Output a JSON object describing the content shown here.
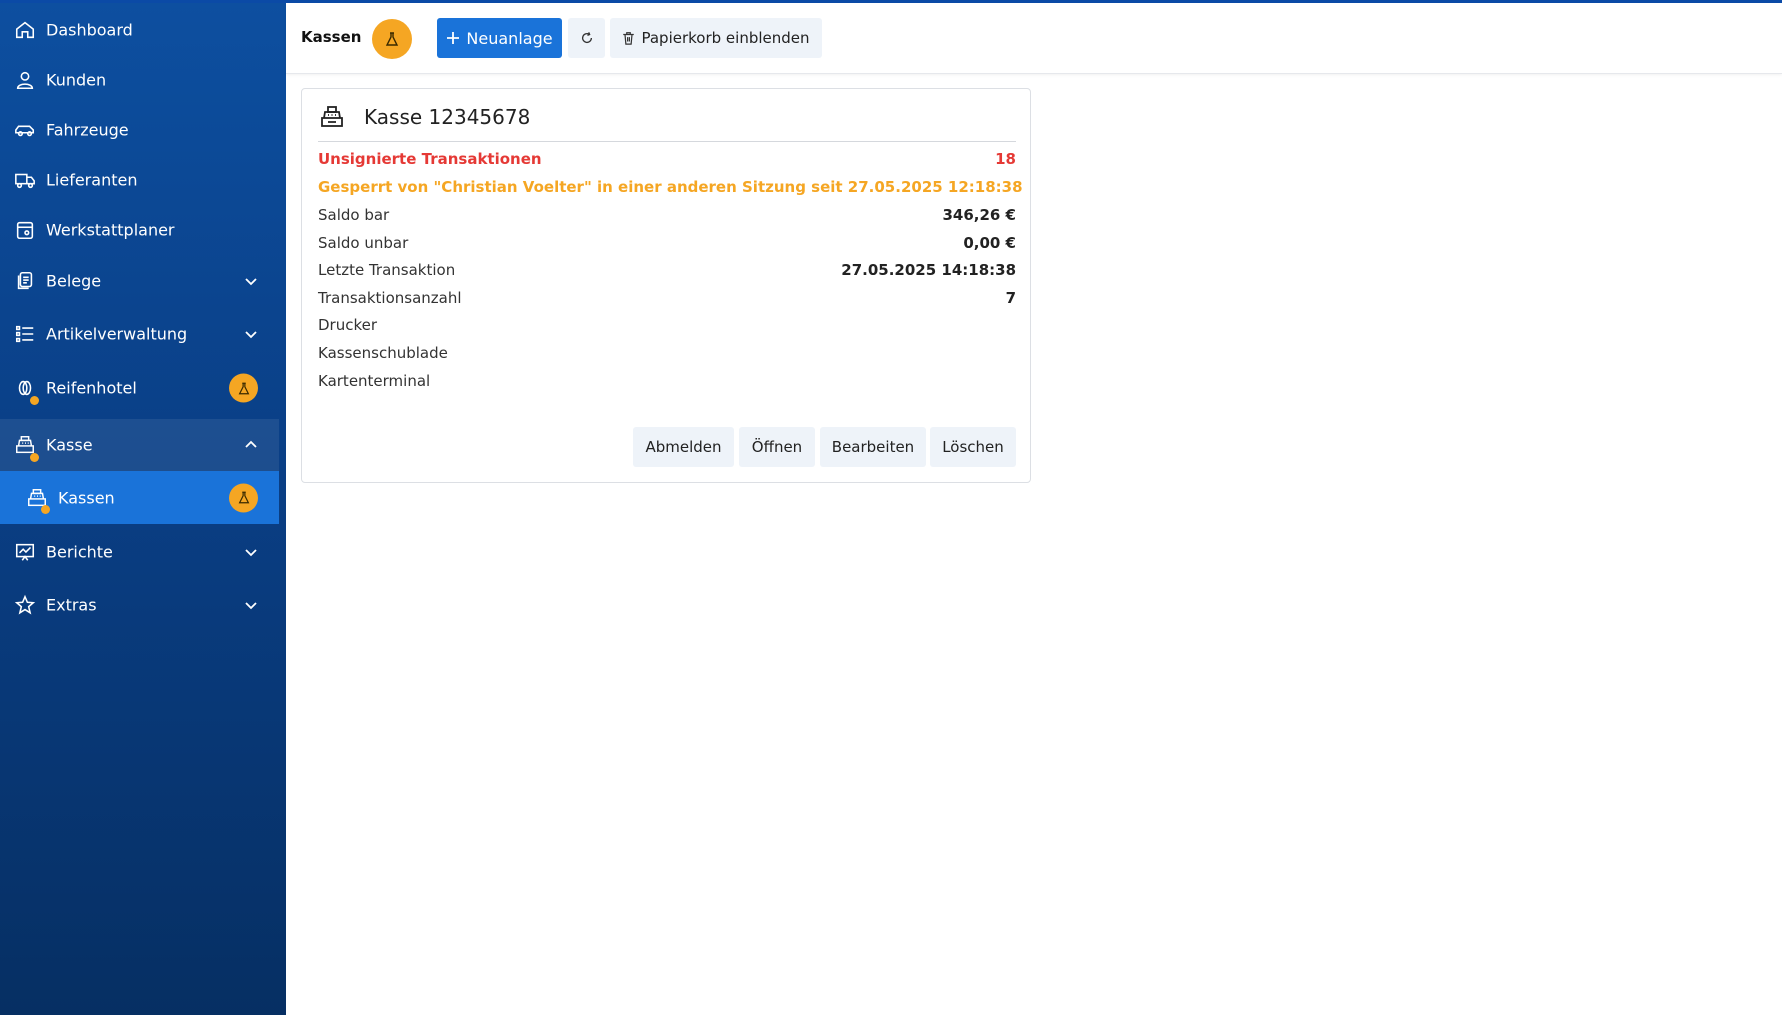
{
  "sidebar": {
    "items": [
      {
        "label": "Dashboard",
        "icon": "home-icon"
      },
      {
        "label": "Kunden",
        "icon": "user-icon"
      },
      {
        "label": "Fahrzeuge",
        "icon": "car-icon"
      },
      {
        "label": "Lieferanten",
        "icon": "truck-icon"
      },
      {
        "label": "Werkstattplaner",
        "icon": "planner-icon"
      },
      {
        "label": "Belege",
        "icon": "documents-icon"
      },
      {
        "label": "Artikelverwaltung",
        "icon": "list-icon"
      },
      {
        "label": "Reifenhotel",
        "icon": "tire-icon"
      },
      {
        "label": "Kasse",
        "icon": "cash-register-icon"
      },
      {
        "label": "Kassen",
        "icon": "cash-register-icon"
      },
      {
        "label": "Berichte",
        "icon": "chart-icon"
      },
      {
        "label": "Extras",
        "icon": "star-icon"
      }
    ]
  },
  "toolbar": {
    "title": "Kassen",
    "new_label": "Neuanlage",
    "trash_label": "Papierkorb einblenden"
  },
  "card": {
    "title": "Kasse 12345678",
    "unsigned_label": "Unsignierte Transaktionen",
    "unsigned_value": "18",
    "locked_text": "Gesperrt von \"Christian Voelter\" in einer anderen Sitzung seit 27.05.2025 12:18:38",
    "rows": [
      {
        "label": "Saldo bar",
        "value": "346,26 €"
      },
      {
        "label": "Saldo unbar",
        "value": "0,00 €"
      },
      {
        "label": "Letzte Transaktion",
        "value": "27.05.2025 14:18:38"
      },
      {
        "label": "Transaktionsanzahl",
        "value": "7"
      },
      {
        "label": "Drucker",
        "value": ""
      },
      {
        "label": "Kassenschublade",
        "value": ""
      },
      {
        "label": "Kartenterminal",
        "value": ""
      }
    ],
    "buttons": {
      "logout": "Abmelden",
      "open": "Öffnen",
      "edit": "Bearbeiten",
      "delete": "Löschen"
    }
  },
  "colors": {
    "sidebar_top": "#0d4fa0",
    "sidebar_bottom": "#062f63",
    "active_item": "#1a73d9",
    "primary_button": "#1a73d9",
    "badge": "#f5a623",
    "warning_text": "#f5a623",
    "error_text": "#e53935"
  }
}
